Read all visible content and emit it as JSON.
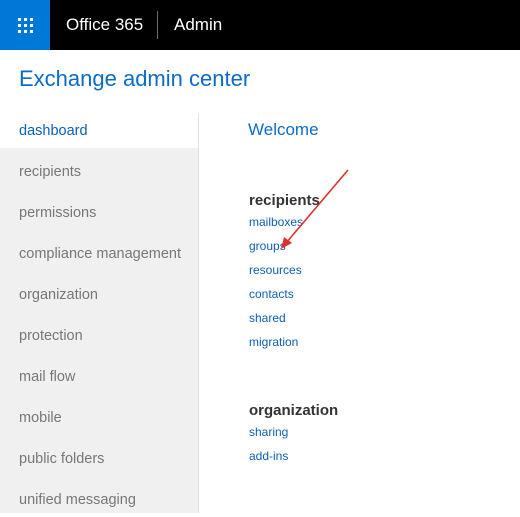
{
  "header": {
    "waffle_icon": "app-launcher-icon",
    "brand": "Office 365",
    "app_name": "Admin",
    "colors": {
      "bar": "#000000",
      "waffle": "#0078d7",
      "text": "#ffffff"
    }
  },
  "page": {
    "title": "Exchange admin center",
    "accent_color": "#0a6cc8"
  },
  "sidebar": {
    "items": [
      {
        "label": "dashboard",
        "active": true
      },
      {
        "label": "recipients",
        "active": false
      },
      {
        "label": "permissions",
        "active": false
      },
      {
        "label": "compliance management",
        "active": false
      },
      {
        "label": "organization",
        "active": false
      },
      {
        "label": "protection",
        "active": false
      },
      {
        "label": "mail flow",
        "active": false
      },
      {
        "label": "mobile",
        "active": false
      },
      {
        "label": "public folders",
        "active": false
      },
      {
        "label": "unified messaging",
        "active": false
      }
    ]
  },
  "main": {
    "welcome": "Welcome",
    "sections": [
      {
        "heading": "recipients",
        "links": [
          "mailboxes",
          "groups",
          "resources",
          "contacts",
          "shared",
          "migration"
        ]
      },
      {
        "heading": "organization",
        "links": [
          "sharing",
          "add-ins"
        ]
      }
    ]
  },
  "annotation": {
    "type": "arrow",
    "color": "#d9342b",
    "points_to": "groups"
  }
}
